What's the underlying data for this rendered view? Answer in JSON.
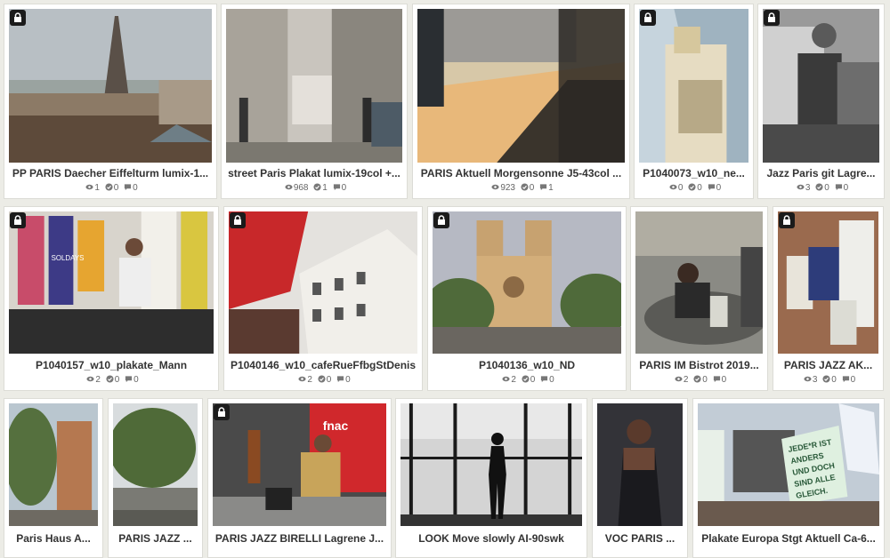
{
  "gallery": {
    "items": [
      {
        "title": "PP PARIS Daecher Eiffelturm lumix-1...",
        "views": "1",
        "likes": "0",
        "comments": "0",
        "locked": true
      },
      {
        "title": "street Paris Plakat lumix-19col +...",
        "views": "968",
        "likes": "1",
        "comments": "0",
        "locked": false
      },
      {
        "title": "PARIS Aktuell Morgensonne J5-43col ...",
        "views": "923",
        "likes": "0",
        "comments": "1",
        "locked": false
      },
      {
        "title": "P1040073_w10_ne...",
        "views": "0",
        "likes": "0",
        "comments": "0",
        "locked": true
      },
      {
        "title": "Jazz Paris git Lagre...",
        "views": "3",
        "likes": "0",
        "comments": "0",
        "locked": true
      },
      {
        "title": "P1040157_w10_plakate_Mann",
        "views": "2",
        "likes": "0",
        "comments": "0",
        "locked": true
      },
      {
        "title": "P1040146_w10_cafeRueFfbgStDenis",
        "views": "2",
        "likes": "0",
        "comments": "0",
        "locked": true
      },
      {
        "title": "P1040136_w10_ND",
        "views": "2",
        "likes": "0",
        "comments": "0",
        "locked": true
      },
      {
        "title": "PARIS IM Bistrot 2019...",
        "views": "2",
        "likes": "0",
        "comments": "0",
        "locked": false
      },
      {
        "title": "PARIS JAZZ AK...",
        "views": "3",
        "likes": "0",
        "comments": "0",
        "locked": true
      },
      {
        "title": "Paris Haus A...",
        "views": "",
        "likes": "",
        "comments": "",
        "locked": false
      },
      {
        "title": "PARIS JAZZ ...",
        "views": "",
        "likes": "",
        "comments": "",
        "locked": false
      },
      {
        "title": "PARIS JAZZ BIRELLI Lagrene J...",
        "views": "",
        "likes": "",
        "comments": "",
        "locked": true
      },
      {
        "title": "LOOK Move slowly AI-90swk",
        "views": "",
        "likes": "",
        "comments": "",
        "locked": false
      },
      {
        "title": "VOC PARIS ...",
        "views": "",
        "likes": "",
        "comments": "",
        "locked": false
      },
      {
        "title": "Plakate Europa Stgt Aktuell Ca-6...",
        "views": "",
        "likes": "",
        "comments": "",
        "locked": false
      }
    ]
  },
  "photo_text": {
    "sign1": "JEDE*R IST",
    "sign2": "ANDERS",
    "sign3": "UND DOCH",
    "sign4": "SIND ALLE",
    "sign5": "GLEICH.",
    "shop": "fnac",
    "poster": "SOLDAYS"
  },
  "icons": {
    "views": "eye-icon",
    "likes": "check-circle-icon",
    "comments": "comment-icon",
    "lock": "lock-icon"
  },
  "colors": {
    "background": "#ecece6",
    "card": "#ffffff",
    "text": "#333333",
    "meta": "#666666",
    "lock_badge": "#1b1b1b"
  }
}
